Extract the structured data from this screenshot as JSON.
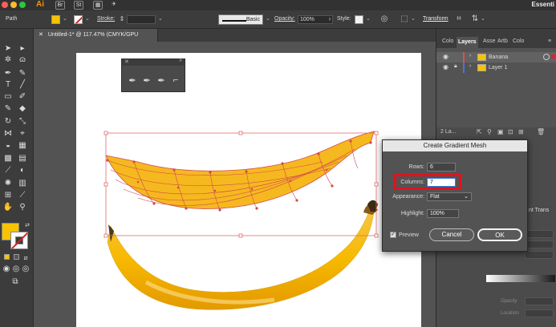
{
  "app": {
    "logo": "Ai",
    "bridge": "Br",
    "stock": "St",
    "workspace": "Essenti"
  },
  "controlbar": {
    "selection_label": "Path",
    "stroke_label": "Stroke:",
    "stroke_profile": "Basic",
    "opacity_label": "Opacity:",
    "opacity_value": "100%",
    "style_label": "Style:",
    "transform_label": "Transform",
    "colors": {
      "fill": "#f7c300",
      "accent": "#d22222"
    }
  },
  "document": {
    "tab_title": "Untitled-1* @ 117.47% (CMYK/GPU Preview)"
  },
  "layers_panel": {
    "tabs": [
      "Colo",
      "Layers",
      "Asse",
      "Artb",
      "Colo"
    ],
    "layers": [
      {
        "name": "Banana",
        "color": "#e05050"
      },
      {
        "name": "Layer 1",
        "color": "#5070e0"
      }
    ],
    "count_label": "2 La..."
  },
  "lower_panel": {
    "tabs": "nt   Trans",
    "opacity_label": "Opacity",
    "location_label": "Location"
  },
  "dialog": {
    "title": "Create Gradient Mesh",
    "rows_label": "Rows:",
    "rows_value": "6",
    "columns_label": "Columns:",
    "columns_value": "7",
    "appearance_label": "Appearance:",
    "appearance_value": "Flat",
    "highlight_label": "Highlight:",
    "highlight_value": "100%",
    "preview_label": "Preview",
    "cancel_label": "Cancel",
    "ok_label": "OK"
  },
  "icons": {
    "pen_tools": [
      "pen-icon",
      "add-anchor-icon",
      "delete-anchor-icon",
      "anchor-point-icon"
    ]
  }
}
